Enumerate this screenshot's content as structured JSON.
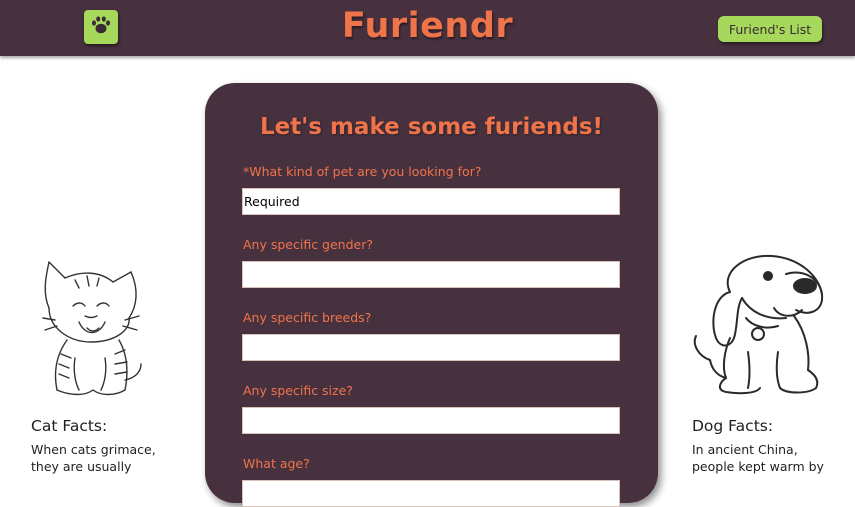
{
  "header": {
    "logo_icon": "paw-icon",
    "title": "Furiendr",
    "list_button": "Furiend's List"
  },
  "form": {
    "heading": "Let's make some furiends!",
    "fields": [
      {
        "label": "*What kind of pet are you looking for?",
        "value": "Required"
      },
      {
        "label": "Any specific gender?",
        "value": ""
      },
      {
        "label": "Any specific breeds?",
        "value": ""
      },
      {
        "label": "Any specific size?",
        "value": ""
      },
      {
        "label": "What age?",
        "value": ""
      }
    ]
  },
  "cat_panel": {
    "image": "cat-illustration",
    "title": "Cat Facts:",
    "text": "When cats grimace, they are usually"
  },
  "dog_panel": {
    "image": "dog-illustration",
    "title": "Dog Facts:",
    "text": "In ancient China, people kept warm by"
  },
  "colors": {
    "header_bg": "#47313f",
    "accent_orange": "#f0744a",
    "accent_green": "#a6d95b"
  }
}
